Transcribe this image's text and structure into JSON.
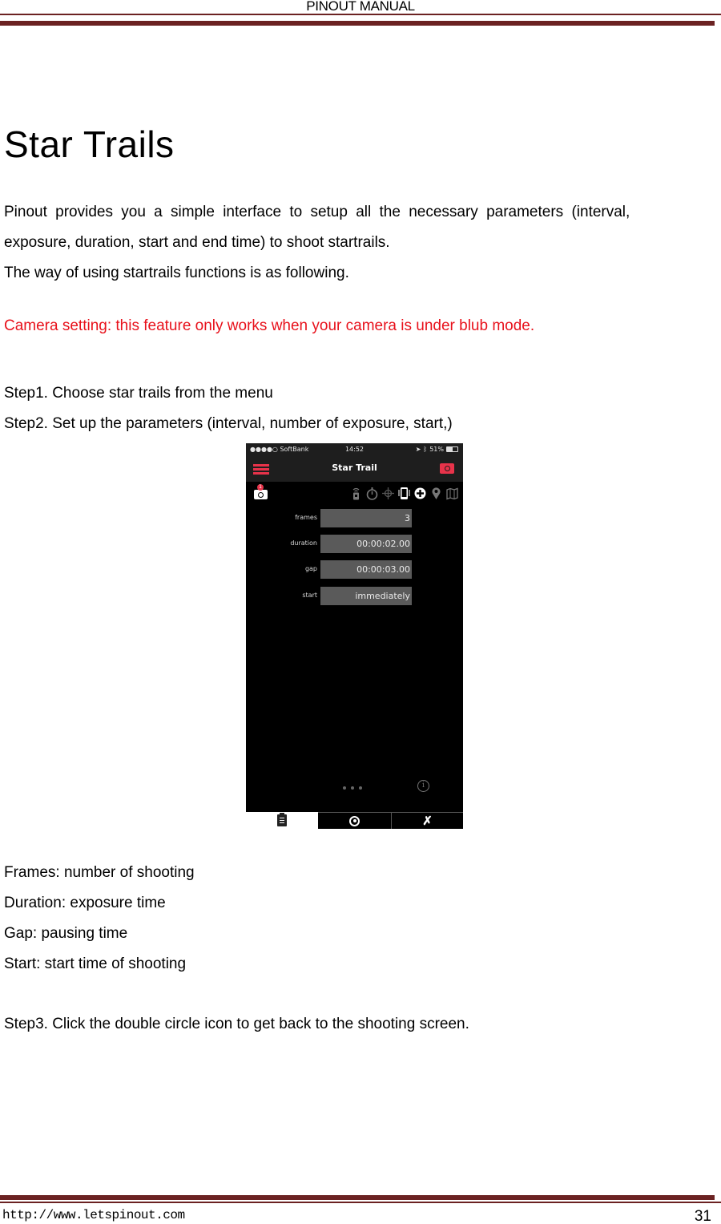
{
  "header": {
    "title": "PINOUT MANUAL"
  },
  "page_title": "Star Trails",
  "intro": {
    "line1": "Pinout provides you a simple interface to setup all the necessary parameters (interval,",
    "line2": "exposure, duration, start and end time) to shoot startrails.",
    "line3": "The way of using startrails functions is as following."
  },
  "camera_note": "Camera setting: this feature only works when your camera is under blub mode.",
  "steps": {
    "step1": "Step1. Choose star trails from the menu",
    "step2": "Step2. Set up the parameters (interval, number of exposure, start,)",
    "step3": "Step3. Click the double circle icon to get back to the shooting screen."
  },
  "app_screenshot": {
    "status_bar": {
      "carrier": "●●●●○ SoftBank",
      "time": "14:52",
      "battery": "51%",
      "battery_level": 0.51
    },
    "nav_title": "Star Trail",
    "camera_badge": "1",
    "toolbar_icons": [
      "remote-icon",
      "timer-icon",
      "crosshair-icon",
      "phone-icon",
      "plus-circle-icon",
      "location-pin-icon",
      "map-icon"
    ],
    "active_toolbar_icons": [
      "phone-icon",
      "plus-circle-icon"
    ],
    "parameters": [
      {
        "label": "frames",
        "value": "3"
      },
      {
        "label": "duration",
        "value": "00:00:02.00"
      },
      {
        "label": "gap",
        "value": "00:00:03.00"
      },
      {
        "label": "start",
        "value": "immediately"
      }
    ],
    "info_glyph": "i",
    "tabs": [
      "clipboard-icon",
      "target-icon",
      "tools-icon"
    ],
    "colors": {
      "accent": "#e8334a",
      "field_bg": "#5a5a5a",
      "bar_bg": "#1e1e1e"
    }
  },
  "descriptions": [
    "Frames: number of shooting",
    "Duration: exposure time",
    "Gap: pausing time",
    "Start: start time of shooting"
  ],
  "footer": {
    "url": "http://www.letspinout.com",
    "page_number": "31"
  },
  "colors": {
    "rule": "#6b2222",
    "warning_text": "#e8111b"
  }
}
